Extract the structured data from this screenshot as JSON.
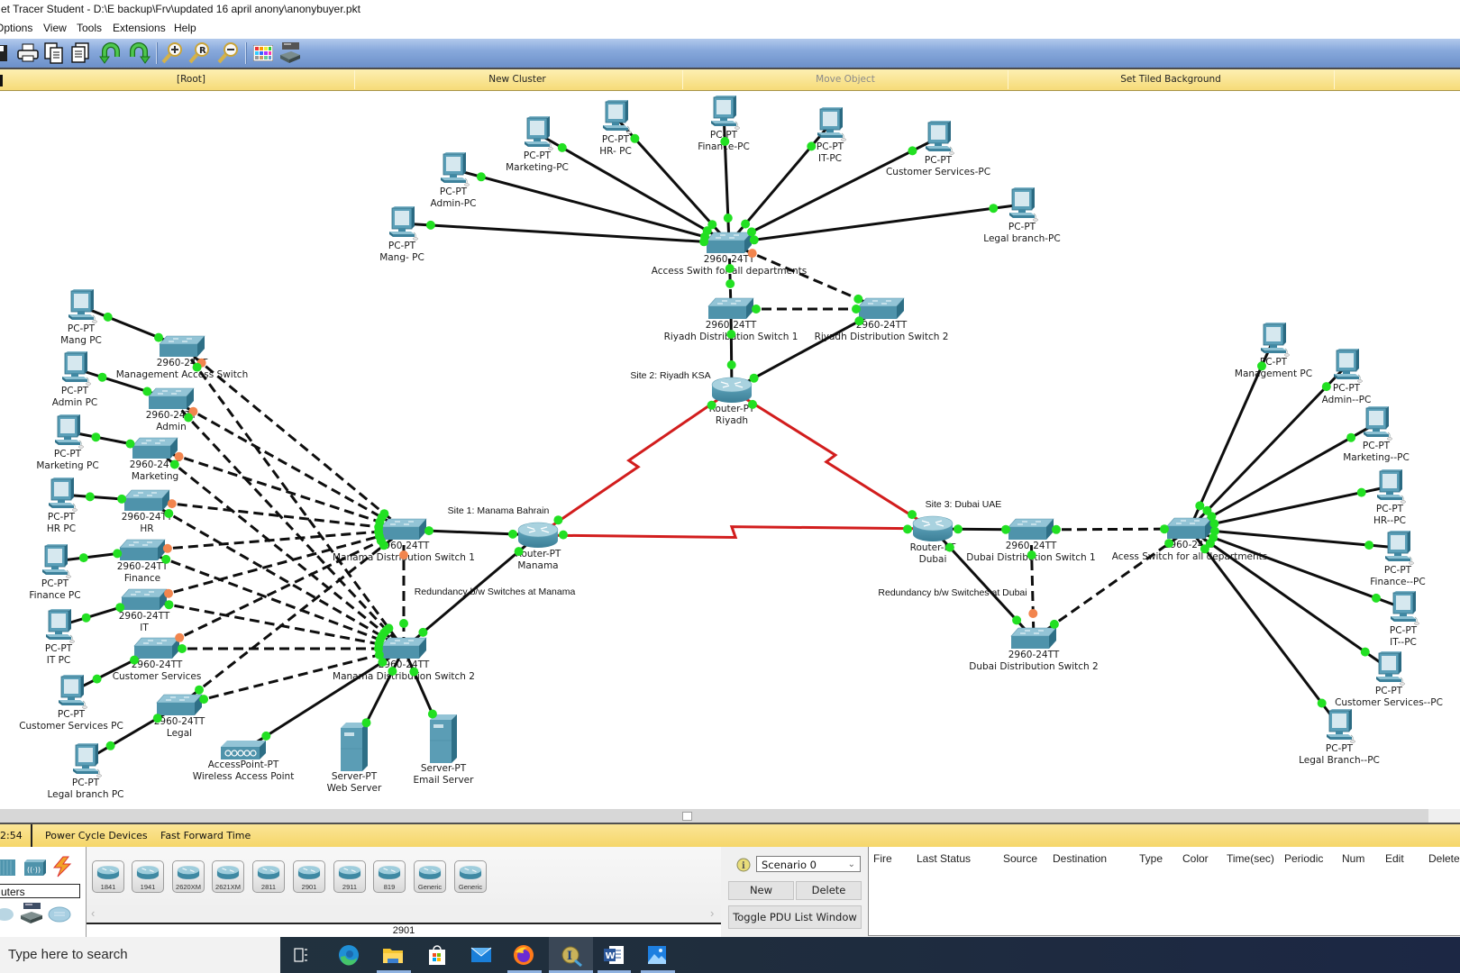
{
  "window": {
    "title": "et Tracer Student - D:\\E backup\\Frv\\updated 16 april anony\\anonybuyer.pkt"
  },
  "menu": {
    "items": [
      "Options",
      "View",
      "Tools",
      "Extensions",
      "Help"
    ]
  },
  "toolbar": {
    "icons": [
      "save-icon",
      "print-icon",
      "copy-icon",
      "paste-icon",
      "undo-icon",
      "redo-icon",
      "zoom-in-icon",
      "zoom-reset-icon",
      "zoom-out-icon",
      "palette-icon",
      "custom-device-icon"
    ]
  },
  "cluster_bar": {
    "root": "[Root]",
    "new_cluster": "New Cluster",
    "move_object": "Move Object",
    "set_tiled_background": "Set Tiled Background"
  },
  "topology": {
    "annotations": {
      "site_manama": "Site 1: Manama Bahrain",
      "site_riyadh": "Site 2: Riyadh KSA",
      "site_dubai": "Site 3: Dubai UAE",
      "redundancy_manama": "Redundancy b/w Switches at Manama",
      "redundancy_dubai": "Redundancy b/w Switches at Dubai"
    },
    "devices": {
      "r_pc_mang": {
        "kind": "pc",
        "model": "PC-PT",
        "name": "Mang- PC"
      },
      "r_pc_admin": {
        "kind": "pc",
        "model": "PC-PT",
        "name": "Admin-PC"
      },
      "r_pc_marketing": {
        "kind": "pc",
        "model": "PC-PT",
        "name": "Marketing-PC"
      },
      "r_pc_hr": {
        "kind": "pc",
        "model": "PC-PT",
        "name": "HR- PC"
      },
      "r_pc_finance": {
        "kind": "pc",
        "model": "PC-PT",
        "name": "Finance-PC"
      },
      "r_pc_it": {
        "kind": "pc",
        "model": "PC-PT",
        "name": "IT-PC"
      },
      "r_pc_cs": {
        "kind": "pc",
        "model": "PC-PT",
        "name": "Customer Services-PC"
      },
      "r_pc_legal": {
        "kind": "pc",
        "model": "PC-PT",
        "name": "Legal branch-PC"
      },
      "r_acc": {
        "kind": "switch",
        "model": "2960-24TT",
        "name": "Access Swith for all departments"
      },
      "r_ds1": {
        "kind": "switch",
        "model": "2960-24TT",
        "name": "Riyadh Distribution Switch 1"
      },
      "r_ds2": {
        "kind": "switch",
        "model": "2960-24TT",
        "name": "Riyadh Distribution Switch 2"
      },
      "r_rtr": {
        "kind": "router",
        "model": "Router-PT",
        "name": "Riyadh"
      },
      "m_pc_mang": {
        "kind": "pc",
        "model": "PC-PT",
        "name": "Mang PC"
      },
      "m_pc_admin": {
        "kind": "pc",
        "model": "PC-PT",
        "name": "Admin PC"
      },
      "m_pc_marketing": {
        "kind": "pc",
        "model": "PC-PT",
        "name": "Marketing PC"
      },
      "m_pc_hr": {
        "kind": "pc",
        "model": "PC-PT",
        "name": "HR PC"
      },
      "m_pc_finance": {
        "kind": "pc",
        "model": "PC-PT",
        "name": "Finance PC"
      },
      "m_pc_it": {
        "kind": "pc",
        "model": "PC-PT",
        "name": "IT PC"
      },
      "m_pc_cs": {
        "kind": "pc",
        "model": "PC-PT",
        "name": "Customer Services PC"
      },
      "m_pc_legal": {
        "kind": "pc",
        "model": "PC-PT",
        "name": "Legal branch PC"
      },
      "m_sw_mgmt": {
        "kind": "switch",
        "model": "2960-24TT",
        "name": "Management Access Switch"
      },
      "m_sw_admin": {
        "kind": "switch",
        "model": "2960-24TT",
        "name": "Admin"
      },
      "m_sw_marketing": {
        "kind": "switch",
        "model": "2960-24TT",
        "name": "Marketing"
      },
      "m_sw_hr": {
        "kind": "switch",
        "model": "2960-24TT",
        "name": "HR"
      },
      "m_sw_finance": {
        "kind": "switch",
        "model": "2960-24TT",
        "name": "Finance"
      },
      "m_sw_it": {
        "kind": "switch",
        "model": "2960-24TT",
        "name": "IT"
      },
      "m_sw_cs": {
        "kind": "switch",
        "model": "2960-24TT",
        "name": "Customer Services"
      },
      "m_sw_legal": {
        "kind": "switch",
        "model": "2960-24TT",
        "name": "Legal"
      },
      "m_ds1": {
        "kind": "switch",
        "model": "2960-24TT",
        "name": "Manama Distribution Switch 1"
      },
      "m_ds2": {
        "kind": "switch",
        "model": "2960-24TT",
        "name": "Manama Distribution Switch 2"
      },
      "m_rtr": {
        "kind": "router",
        "model": "Router-PT",
        "name": "Manama"
      },
      "m_srv_web": {
        "kind": "server",
        "model": "Server-PT",
        "name": "Web Server"
      },
      "m_srv_email": {
        "kind": "server",
        "model": "Server-PT",
        "name": "Email Server"
      },
      "m_ap": {
        "kind": "ap",
        "model": "AccessPoint-PT",
        "name": "Wireless Access Point"
      },
      "d_rtr": {
        "kind": "router",
        "model": "Router-PT",
        "name": "Dubai"
      },
      "d_ds1": {
        "kind": "switch",
        "model": "2960-24TT",
        "name": "Dubai Distribution Switch 1"
      },
      "d_ds2": {
        "kind": "switch",
        "model": "2960-24TT",
        "name": "Dubai Distribution Switch 2"
      },
      "d_acc": {
        "kind": "switch",
        "model": "2960-24TT",
        "name": "Acess Switch for all departments"
      },
      "d_pc_mgmt": {
        "kind": "pc",
        "model": "PC-PT",
        "name": "Management PC"
      },
      "d_pc_admin": {
        "kind": "pc",
        "model": "PC-PT",
        "name": "Admin--PC"
      },
      "d_pc_marketing": {
        "kind": "pc",
        "model": "PC-PT",
        "name": "Marketing--PC"
      },
      "d_pc_hr": {
        "kind": "pc",
        "model": "PC-PT",
        "name": "HR--PC"
      },
      "d_pc_finance": {
        "kind": "pc",
        "model": "PC-PT",
        "name": "Finance--PC"
      },
      "d_pc_it": {
        "kind": "pc",
        "model": "PC-PT",
        "name": "IT--PC"
      },
      "d_pc_cs": {
        "kind": "pc",
        "model": "PC-PT",
        "name": "Customer Services--PC"
      },
      "d_pc_legal": {
        "kind": "pc",
        "model": "PC-PT",
        "name": "Legal Branch--PC"
      }
    },
    "links": [
      {
        "a": "r_pc_mang",
        "b": "r_acc",
        "cable": "straight",
        "ports": [
          "up",
          "up"
        ]
      },
      {
        "a": "r_pc_admin",
        "b": "r_acc",
        "cable": "straight",
        "ports": [
          "up",
          "up"
        ]
      },
      {
        "a": "r_pc_marketing",
        "b": "r_acc",
        "cable": "straight",
        "ports": [
          "up",
          "up"
        ]
      },
      {
        "a": "r_pc_hr",
        "b": "r_acc",
        "cable": "straight",
        "ports": [
          "up",
          "up"
        ]
      },
      {
        "a": "r_pc_finance",
        "b": "r_acc",
        "cable": "straight",
        "ports": [
          "up",
          "up"
        ]
      },
      {
        "a": "r_pc_it",
        "b": "r_acc",
        "cable": "straight",
        "ports": [
          "up",
          "up"
        ]
      },
      {
        "a": "r_pc_cs",
        "b": "r_acc",
        "cable": "straight",
        "ports": [
          "up",
          "up"
        ]
      },
      {
        "a": "r_pc_legal",
        "b": "r_acc",
        "cable": "straight",
        "ports": [
          "up",
          "up"
        ]
      },
      {
        "a": "r_acc",
        "b": "r_ds1",
        "cable": "cross",
        "ports": [
          "up",
          "up"
        ]
      },
      {
        "a": "r_acc",
        "b": "r_ds2",
        "cable": "cross",
        "ports": [
          "blocking",
          "up"
        ]
      },
      {
        "a": "r_ds1",
        "b": "r_ds2",
        "cable": "cross",
        "ports": [
          "up",
          "up"
        ]
      },
      {
        "a": "r_ds1",
        "b": "r_rtr",
        "cable": "straight",
        "ports": [
          "up",
          "up"
        ]
      },
      {
        "a": "r_ds2",
        "b": "r_rtr",
        "cable": "straight",
        "ports": [
          "up",
          "up"
        ]
      },
      {
        "a": "m_pc_mang",
        "b": "m_sw_mgmt",
        "cable": "straight",
        "ports": [
          "up",
          "up"
        ]
      },
      {
        "a": "m_pc_admin",
        "b": "m_sw_admin",
        "cable": "straight",
        "ports": [
          "up",
          "up"
        ]
      },
      {
        "a": "m_pc_marketing",
        "b": "m_sw_marketing",
        "cable": "straight",
        "ports": [
          "up",
          "up"
        ]
      },
      {
        "a": "m_pc_hr",
        "b": "m_sw_hr",
        "cable": "straight",
        "ports": [
          "up",
          "up"
        ]
      },
      {
        "a": "m_pc_finance",
        "b": "m_sw_finance",
        "cable": "straight",
        "ports": [
          "up",
          "up"
        ]
      },
      {
        "a": "m_pc_it",
        "b": "m_sw_it",
        "cable": "straight",
        "ports": [
          "up",
          "up"
        ]
      },
      {
        "a": "m_pc_cs",
        "b": "m_sw_cs",
        "cable": "straight",
        "ports": [
          "up",
          "up"
        ]
      },
      {
        "a": "m_pc_legal",
        "b": "m_sw_legal",
        "cable": "straight",
        "ports": [
          "up",
          "up"
        ]
      },
      {
        "a": "m_sw_mgmt",
        "b": "m_ds1",
        "cable": "cross",
        "ports": [
          "blocking",
          "up"
        ]
      },
      {
        "a": "m_sw_mgmt",
        "b": "m_ds2",
        "cable": "cross",
        "ports": [
          "up",
          "up"
        ]
      },
      {
        "a": "m_sw_admin",
        "b": "m_ds1",
        "cable": "cross",
        "ports": [
          "blocking",
          "up"
        ]
      },
      {
        "a": "m_sw_admin",
        "b": "m_ds2",
        "cable": "cross",
        "ports": [
          "up",
          "up"
        ]
      },
      {
        "a": "m_sw_marketing",
        "b": "m_ds1",
        "cable": "cross",
        "ports": [
          "blocking",
          "up"
        ]
      },
      {
        "a": "m_sw_marketing",
        "b": "m_ds2",
        "cable": "cross",
        "ports": [
          "up",
          "up"
        ]
      },
      {
        "a": "m_sw_hr",
        "b": "m_ds1",
        "cable": "cross",
        "ports": [
          "blocking",
          "up"
        ]
      },
      {
        "a": "m_sw_hr",
        "b": "m_ds2",
        "cable": "cross",
        "ports": [
          "up",
          "up"
        ]
      },
      {
        "a": "m_sw_finance",
        "b": "m_ds1",
        "cable": "cross",
        "ports": [
          "blocking",
          "up"
        ]
      },
      {
        "a": "m_sw_finance",
        "b": "m_ds2",
        "cable": "cross",
        "ports": [
          "up",
          "up"
        ]
      },
      {
        "a": "m_sw_it",
        "b": "m_ds1",
        "cable": "cross",
        "ports": [
          "blocking",
          "up"
        ]
      },
      {
        "a": "m_sw_it",
        "b": "m_ds2",
        "cable": "cross",
        "ports": [
          "up",
          "up"
        ]
      },
      {
        "a": "m_sw_cs",
        "b": "m_ds1",
        "cable": "cross",
        "ports": [
          "blocking",
          "up"
        ]
      },
      {
        "a": "m_sw_cs",
        "b": "m_ds2",
        "cable": "cross",
        "ports": [
          "up",
          "up"
        ]
      },
      {
        "a": "m_sw_legal",
        "b": "m_ds1",
        "cable": "cross",
        "ports": [
          "up",
          "up"
        ]
      },
      {
        "a": "m_sw_legal",
        "b": "m_ds2",
        "cable": "cross",
        "ports": [
          "up",
          "up"
        ]
      },
      {
        "a": "m_ds1",
        "b": "m_ds2",
        "cable": "cross",
        "ports": [
          "blocking",
          "up"
        ]
      },
      {
        "a": "m_ds1",
        "b": "m_rtr",
        "cable": "straight",
        "ports": [
          "up",
          "up"
        ]
      },
      {
        "a": "m_ds2",
        "b": "m_rtr",
        "cable": "straight",
        "ports": [
          "up",
          "up"
        ]
      },
      {
        "a": "m_ds2",
        "b": "m_srv_web",
        "cable": "straight",
        "ports": [
          "up",
          "up"
        ]
      },
      {
        "a": "m_ds2",
        "b": "m_srv_email",
        "cable": "straight",
        "ports": [
          "up",
          "up"
        ]
      },
      {
        "a": "m_ds2",
        "b": "m_ap",
        "cable": "straight",
        "ports": [
          "up",
          "up"
        ]
      },
      {
        "a": "d_rtr",
        "b": "d_ds1",
        "cable": "straight",
        "ports": [
          "up",
          "up"
        ]
      },
      {
        "a": "d_rtr",
        "b": "d_ds2",
        "cable": "straight",
        "ports": [
          "up",
          "up"
        ]
      },
      {
        "a": "d_ds1",
        "b": "d_ds2",
        "cable": "cross",
        "ports": [
          "up",
          "blocking"
        ]
      },
      {
        "a": "d_ds1",
        "b": "d_acc",
        "cable": "cross",
        "ports": [
          "up",
          "up"
        ]
      },
      {
        "a": "d_ds2",
        "b": "d_acc",
        "cable": "cross",
        "ports": [
          "up",
          "up"
        ]
      },
      {
        "a": "d_pc_mgmt",
        "b": "d_acc",
        "cable": "straight",
        "ports": [
          "up",
          "up"
        ]
      },
      {
        "a": "d_pc_admin",
        "b": "d_acc",
        "cable": "straight",
        "ports": [
          "up",
          "up"
        ]
      },
      {
        "a": "d_pc_marketing",
        "b": "d_acc",
        "cable": "straight",
        "ports": [
          "up",
          "up"
        ]
      },
      {
        "a": "d_pc_hr",
        "b": "d_acc",
        "cable": "straight",
        "ports": [
          "up",
          "up"
        ]
      },
      {
        "a": "d_pc_finance",
        "b": "d_acc",
        "cable": "straight",
        "ports": [
          "up",
          "up"
        ]
      },
      {
        "a": "d_pc_it",
        "b": "d_acc",
        "cable": "straight",
        "ports": [
          "up",
          "up"
        ]
      },
      {
        "a": "d_pc_cs",
        "b": "d_acc",
        "cable": "straight",
        "ports": [
          "up",
          "up"
        ]
      },
      {
        "a": "d_pc_legal",
        "b": "d_acc",
        "cable": "straight",
        "ports": [
          "up",
          "up"
        ]
      },
      {
        "a": "m_rtr",
        "b": "r_rtr",
        "cable": "serial",
        "ports": [
          "up",
          "up"
        ]
      },
      {
        "a": "r_rtr",
        "b": "d_rtr",
        "cable": "serial",
        "ports": [
          "up",
          "up"
        ]
      },
      {
        "a": "m_rtr",
        "b": "d_rtr",
        "cable": "serial",
        "ports": [
          "up",
          "up"
        ]
      }
    ]
  },
  "colors": {
    "port_up": "#22e022",
    "port_blocking": "#f2854e",
    "serial_link": "#d21d1d",
    "copper_link": "#0e0e0e",
    "toolbar_blue": "#7d9fd5",
    "bar_yellow": "#f7dc7c",
    "device_teal": "#4f93ab"
  },
  "realtime_bar": {
    "time": "2:54",
    "power_cycle": "Power Cycle Devices",
    "fast_forward": "Fast Forward Time"
  },
  "device_panel": {
    "category_field": "uters",
    "models": [
      "1841",
      "1941",
      "2620XM",
      "2621XM",
      "2811",
      "2901",
      "2911",
      "819",
      "Generic",
      "Generic"
    ],
    "selected_model": "2901"
  },
  "scenario_panel": {
    "scenario": "Scenario 0",
    "new": "New",
    "delete": "Delete",
    "toggle": "Toggle PDU List Window"
  },
  "pdu_list": {
    "columns": [
      "Fire",
      "Last Status",
      "Source",
      "Destination",
      "Type",
      "Color",
      "Time(sec)",
      "Periodic",
      "Num",
      "Edit",
      "Delete"
    ]
  },
  "taskbar": {
    "search_placeholder": "Type here to search",
    "apps": [
      "task-view",
      "edge",
      "file-explorer",
      "store",
      "mail",
      "firefox",
      "packet-tracer",
      "word",
      "photos"
    ]
  }
}
